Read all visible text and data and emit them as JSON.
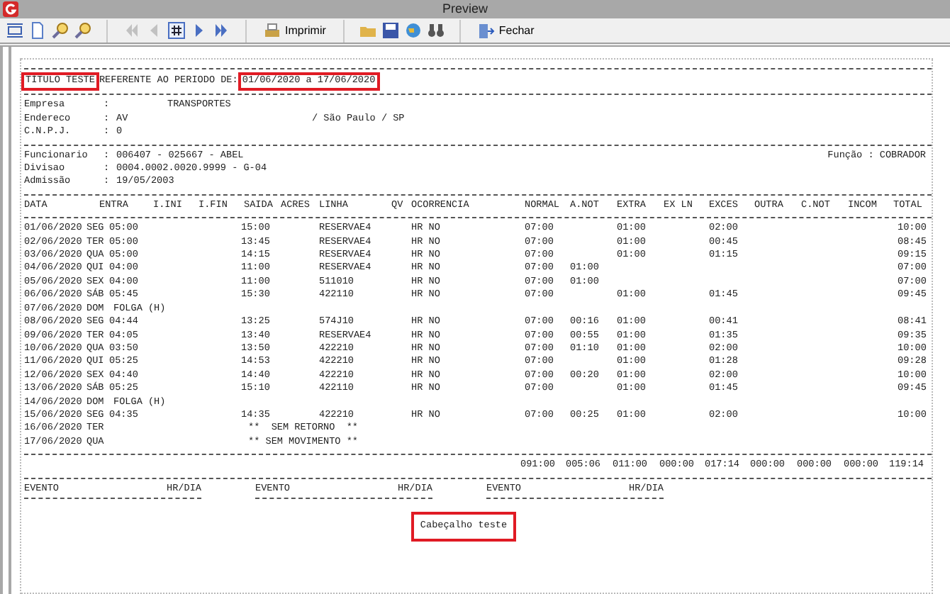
{
  "window": {
    "title": "Preview"
  },
  "toolbar": {
    "nav_buttons": [
      {
        "disabled": true
      },
      {
        "disabled": true
      },
      {
        "disabled": false
      },
      {
        "disabled": false
      },
      {
        "disabled": false
      }
    ],
    "print_label": "Imprimir",
    "close_label": "Fechar"
  },
  "report": {
    "title": {
      "text": "TÍTULO TESTE",
      "highlighted": true
    },
    "period_label": "REFERENTE AO PERIODO DE:",
    "period": {
      "text": "01/06/2020 a 17/06/2020",
      "highlighted": true
    },
    "company": [
      {
        "label": "Empresa",
        "sep": ":",
        "value": "TRANSPORTES"
      },
      {
        "label": "Endereco",
        "sep": ":",
        "value": "AV",
        "extra": "/ São Paulo / SP"
      },
      {
        "label": "C.N.P.J.",
        "sep": ":",
        "value": "0"
      }
    ],
    "employee": [
      {
        "label": "Funcionario",
        "sep": ":",
        "value": "006407 - 025667 - ABEL",
        "extra": "Função : COBRADOR"
      },
      {
        "label": "Divisao",
        "sep": ":",
        "value": "0004.0002.0020.9999 - G-04"
      },
      {
        "label": "Admissão",
        "sep": ":",
        "value": "19/05/2003"
      }
    ],
    "columns": [
      "DATA",
      "ENTRA",
      "I.INI",
      "I.FIN",
      "SAIDA",
      "ACRES",
      "LINHA",
      "QV",
      "OCORRENCIA",
      "NORMAL",
      "A.NOT",
      "EXTRA",
      "EX LN",
      "EXCES",
      "OUTRA",
      "C.NOT",
      "INCOM",
      "TOTAL"
    ],
    "rows": [
      {
        "kind": "work",
        "date": "01/06/2020",
        "day": "SEG",
        "entra": "05:00",
        "saida": "15:00",
        "linha": "RESERVAE4",
        "ocorrencia": "HR NO",
        "normal": "07:00",
        "extra": "01:00",
        "exces": "02:00",
        "total": "10:00"
      },
      {
        "kind": "work",
        "date": "02/06/2020",
        "day": "TER",
        "entra": "05:00",
        "saida": "13:45",
        "linha": "RESERVAE4",
        "ocorrencia": "HR NO",
        "normal": "07:00",
        "extra": "01:00",
        "exces": "00:45",
        "total": "08:45"
      },
      {
        "kind": "work",
        "date": "03/06/2020",
        "day": "QUA",
        "entra": "05:00",
        "saida": "14:15",
        "linha": "RESERVAE4",
        "ocorrencia": "HR NO",
        "normal": "07:00",
        "extra": "01:00",
        "exces": "01:15",
        "total": "09:15"
      },
      {
        "kind": "work",
        "date": "04/06/2020",
        "day": "QUI",
        "entra": "04:00",
        "saida": "11:00",
        "linha": "RESERVAE4",
        "ocorrencia": "HR NO",
        "normal": "07:00",
        "anot": "01:00",
        "total": "07:00"
      },
      {
        "kind": "work",
        "date": "05/06/2020",
        "day": "SEX",
        "entra": "04:00",
        "saida": "11:00",
        "linha": "511010",
        "ocorrencia": "HR NO",
        "normal": "07:00",
        "anot": "01:00",
        "total": "07:00"
      },
      {
        "kind": "work",
        "date": "06/06/2020",
        "day": "SÁB",
        "entra": "05:45",
        "saida": "15:30",
        "linha": "422110",
        "ocorrencia": "HR NO",
        "normal": "07:00",
        "extra": "01:00",
        "exces": "01:45",
        "total": "09:45"
      },
      {
        "kind": "folga",
        "date": "07/06/2020",
        "day": "DOM",
        "note": "FOLGA (H)"
      },
      {
        "kind": "work",
        "date": "08/06/2020",
        "day": "SEG",
        "entra": "04:44",
        "saida": "13:25",
        "linha": "574J10",
        "ocorrencia": "HR NO",
        "normal": "07:00",
        "anot": "00:16",
        "extra": "01:00",
        "exces": "00:41",
        "total": "08:41"
      },
      {
        "kind": "work",
        "date": "09/06/2020",
        "day": "TER",
        "entra": "04:05",
        "saida": "13:40",
        "linha": "RESERVAE4",
        "ocorrencia": "HR NO",
        "normal": "07:00",
        "anot": "00:55",
        "extra": "01:00",
        "exces": "01:35",
        "total": "09:35"
      },
      {
        "kind": "work",
        "date": "10/06/2020",
        "day": "QUA",
        "entra": "03:50",
        "saida": "13:50",
        "linha": "422210",
        "ocorrencia": "HR NO",
        "normal": "07:00",
        "anot": "01:10",
        "extra": "01:00",
        "exces": "02:00",
        "total": "10:00"
      },
      {
        "kind": "work",
        "date": "11/06/2020",
        "day": "QUI",
        "entra": "05:25",
        "saida": "14:53",
        "linha": "422210",
        "ocorrencia": "HR NO",
        "normal": "07:00",
        "extra": "01:00",
        "exces": "01:28",
        "total": "09:28"
      },
      {
        "kind": "work",
        "date": "12/06/2020",
        "day": "SEX",
        "entra": "04:40",
        "saida": "14:40",
        "linha": "422210",
        "ocorrencia": "HR NO",
        "normal": "07:00",
        "anot": "00:20",
        "extra": "01:00",
        "exces": "02:00",
        "total": "10:00"
      },
      {
        "kind": "work",
        "date": "13/06/2020",
        "day": "SÁB",
        "entra": "05:25",
        "saida": "15:10",
        "linha": "422110",
        "ocorrencia": "HR NO",
        "normal": "07:00",
        "extra": "01:00",
        "exces": "01:45",
        "total": "09:45"
      },
      {
        "kind": "folga",
        "date": "14/06/2020",
        "day": "DOM",
        "note": "FOLGA (H)"
      },
      {
        "kind": "work",
        "date": "15/06/2020",
        "day": "SEG",
        "entra": "04:35",
        "saida": "14:35",
        "linha": "422210",
        "ocorrencia": "HR NO",
        "normal": "07:00",
        "anot": "00:25",
        "extra": "01:00",
        "exces": "02:00",
        "total": "10:00"
      },
      {
        "kind": "note",
        "date": "16/06/2020",
        "day": "TER",
        "note": "**  SEM RETORNO  **"
      },
      {
        "kind": "note",
        "date": "17/06/2020",
        "day": "QUA",
        "note": "** SEM MOVIMENTO **"
      }
    ],
    "totals": [
      "091:00",
      "005:06",
      "011:00",
      "000:00",
      "017:14",
      "000:00",
      "000:00",
      "000:00",
      "119:14"
    ],
    "events": [
      {
        "event": "EVENTO",
        "hours": "HR/DIA"
      },
      {
        "event": "EVENTO",
        "hours": "HR/DIA"
      },
      {
        "event": "EVENTO",
        "hours": "HR/DIA"
      }
    ],
    "footer": {
      "text": "Cabeçalho teste",
      "highlighted": true
    }
  }
}
